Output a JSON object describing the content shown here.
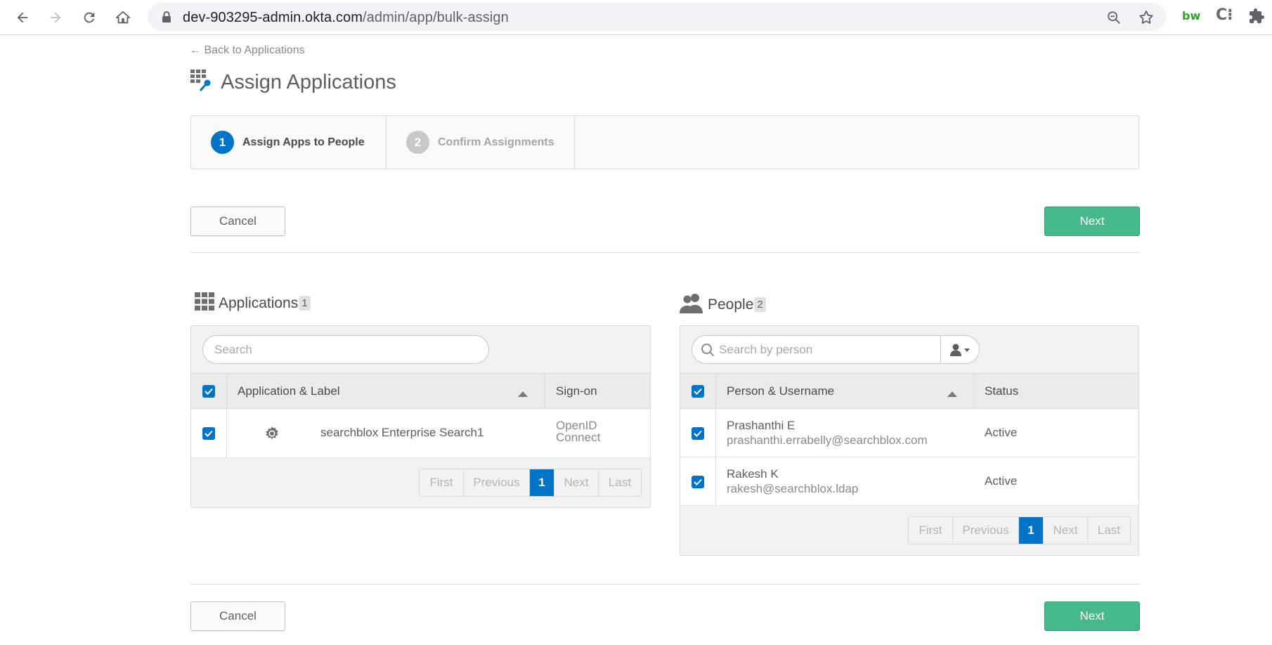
{
  "browser": {
    "url_host": "dev-903295-admin.okta.com",
    "url_path": "/admin/app/bulk-assign",
    "extensions": [
      "bw",
      "C⁝",
      "puzzle"
    ]
  },
  "page": {
    "back_link": "← Back to Applications",
    "title": "Assign Applications",
    "steps": [
      {
        "number": "1",
        "label": "Assign Apps to People",
        "state": "active"
      },
      {
        "number": "2",
        "label": "Confirm Assignments",
        "state": "inactive"
      }
    ],
    "cancel_label": "Cancel",
    "next_label": "Next"
  },
  "applications": {
    "title": "Applications",
    "count": "1",
    "search_placeholder": "Search",
    "columns": [
      "Application & Label",
      "Sign-on"
    ],
    "rows": [
      {
        "name": "searchblox Enterprise Search1",
        "signon_line1": "OpenID",
        "signon_line2": "Connect",
        "checked": true
      }
    ],
    "pager": [
      "First",
      "Previous",
      "1",
      "Next",
      "Last"
    ]
  },
  "people": {
    "title": "People",
    "count": "2",
    "search_placeholder": "Search by person",
    "columns": [
      "Person & Username",
      "Status"
    ],
    "rows": [
      {
        "name": "Prashanthi E",
        "username": "prashanthi.errabelly@searchblox.com",
        "status": "Active",
        "checked": true
      },
      {
        "name": "Rakesh K",
        "username": "rakesh@searchblox.ldap",
        "status": "Active",
        "checked": true
      }
    ],
    "pager": [
      "First",
      "Previous",
      "1",
      "Next",
      "Last"
    ]
  },
  "colors": {
    "accent_blue": "#0074c7",
    "next_green": "#46b98c"
  }
}
